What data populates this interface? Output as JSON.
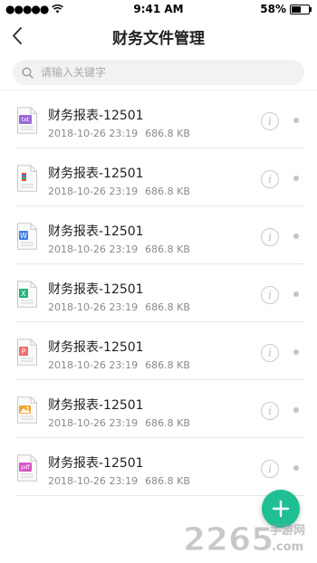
{
  "status_bar": {
    "time": "9:41 AM",
    "battery_percent": "58%",
    "battery_level": 0.58
  },
  "header": {
    "title": "财务文件管理"
  },
  "search": {
    "placeholder": "请输入关键字"
  },
  "files": [
    {
      "name": "财务报表-12501",
      "date": "2018-10-26 23:19",
      "size": "686.8 KB",
      "type": "txt",
      "icon_label": "txt",
      "color": "#9b6ad6"
    },
    {
      "name": "财务报表-12501",
      "date": "2018-10-26 23:19",
      "size": "686.8 KB",
      "type": "rar",
      "icon_label": "",
      "color": "#e64a3b"
    },
    {
      "name": "财务报表-12501",
      "date": "2018-10-26 23:19",
      "size": "686.8 KB",
      "type": "word",
      "icon_label": "W",
      "color": "#3c7ee8"
    },
    {
      "name": "财务报表-12501",
      "date": "2018-10-26 23:19",
      "size": "686.8 KB",
      "type": "excel",
      "icon_label": "X",
      "color": "#1fb57a"
    },
    {
      "name": "财务报表-12501",
      "date": "2018-10-26 23:19",
      "size": "686.8 KB",
      "type": "ppt",
      "icon_label": "P",
      "color": "#f06b6b"
    },
    {
      "name": "财务报表-12501",
      "date": "2018-10-26 23:19",
      "size": "686.8 KB",
      "type": "image",
      "icon_label": "",
      "color": "#f3a42b"
    },
    {
      "name": "财务报表-12501",
      "date": "2018-10-26 23:19",
      "size": "686.8 KB",
      "type": "pdf",
      "icon_label": "pdf",
      "color": "#d855c8"
    }
  ],
  "fab": {
    "icon": "plus-icon",
    "color": "#1fbf94"
  },
  "watermark": {
    "text": "2265",
    "subtext": "手游网",
    "domain": ".com"
  },
  "colors": {
    "accent": "#1fbf94",
    "text_primary": "#222222",
    "text_secondary": "#8a8a8a"
  }
}
